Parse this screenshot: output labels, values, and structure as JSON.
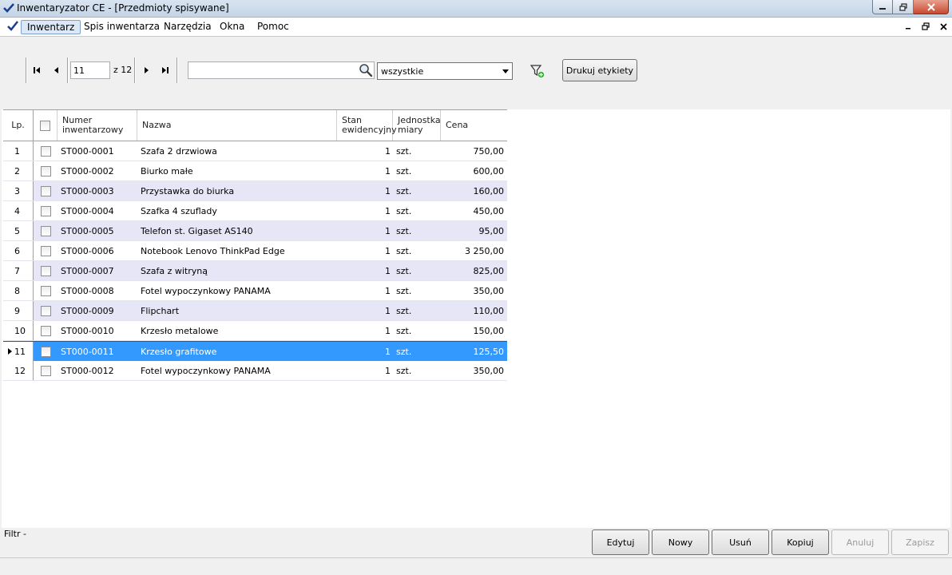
{
  "window": {
    "title": "Inwentaryzator CE - [Przedmioty spisywane]"
  },
  "menu": {
    "items": [
      {
        "label": "Inwentarz",
        "active": true
      },
      {
        "label": "Spis inwentarza"
      },
      {
        "label": "Narzędzia"
      },
      {
        "label": "Okna"
      },
      {
        "label": "Pomoc"
      }
    ]
  },
  "toolbar": {
    "page_value": "11",
    "page_total": "z 12",
    "search_value": "",
    "filter_combo": "wszystkie",
    "print_labels": "Drukuj etykiety"
  },
  "grid": {
    "headers": {
      "lp": "Lp.",
      "numer_line1": "Numer",
      "numer_line2": "inwentarzowy",
      "nazwa": "Nazwa",
      "stan_line1": "Stan",
      "stan_line2": "ewidencyjny",
      "jm_line1": "Jednostka",
      "jm_line2": "miary",
      "cena": "Cena"
    },
    "rows": [
      {
        "lp": "1",
        "numer": "ST000-0001",
        "nazwa": "Szafa 2 drzwiowa",
        "stan": "1",
        "jm": "szt.",
        "cena": "750,00"
      },
      {
        "lp": "2",
        "numer": "ST000-0002",
        "nazwa": "Biurko małe",
        "stan": "1",
        "jm": "szt.",
        "cena": "600,00"
      },
      {
        "lp": "3",
        "numer": "ST000-0003",
        "nazwa": "Przystawka do biurka",
        "stan": "1",
        "jm": "szt.",
        "cena": "160,00"
      },
      {
        "lp": "4",
        "numer": "ST000-0004",
        "nazwa": "Szafka 4 szuflady",
        "stan": "1",
        "jm": "szt.",
        "cena": "450,00"
      },
      {
        "lp": "5",
        "numer": "ST000-0005",
        "nazwa": "Telefon st. Gigaset AS140",
        "stan": "1",
        "jm": "szt.",
        "cena": "95,00"
      },
      {
        "lp": "6",
        "numer": "ST000-0006",
        "nazwa": "Notebook Lenovo ThinkPad Edge",
        "stan": "1",
        "jm": "szt.",
        "cena": "3 250,00"
      },
      {
        "lp": "7",
        "numer": "ST000-0007",
        "nazwa": "Szafa z witryną",
        "stan": "1",
        "jm": "szt.",
        "cena": "825,00"
      },
      {
        "lp": "8",
        "numer": "ST000-0008",
        "nazwa": "Fotel wypoczynkowy PANAMA",
        "stan": "1",
        "jm": "szt.",
        "cena": "350,00"
      },
      {
        "lp": "9",
        "numer": "ST000-0009",
        "nazwa": "Flipchart",
        "stan": "1",
        "jm": "szt.",
        "cena": "110,00"
      },
      {
        "lp": "10",
        "numer": "ST000-0010",
        "nazwa": "Krzesło metalowe",
        "stan": "1",
        "jm": "szt.",
        "cena": "150,00"
      },
      {
        "lp": "11",
        "numer": "ST000-0011",
        "nazwa": "Krzesło grafitowe",
        "stan": "1",
        "jm": "szt.",
        "cena": "125,50",
        "selected": true
      },
      {
        "lp": "12",
        "numer": "ST000-0012",
        "nazwa": "Fotel wypoczynkowy PANAMA",
        "stan": "1",
        "jm": "szt.",
        "cena": "350,00"
      }
    ]
  },
  "bottom": {
    "filter_label": "Filtr -",
    "buttons": [
      {
        "label": "Edytuj",
        "enabled": true
      },
      {
        "label": "Nowy",
        "enabled": true
      },
      {
        "label": "Usuń",
        "enabled": true
      },
      {
        "label": "Kopiuj",
        "enabled": true
      },
      {
        "label": "Anuluj",
        "enabled": false
      },
      {
        "label": "Zapisz",
        "enabled": false
      }
    ]
  },
  "colors": {
    "selection": "#3399ff",
    "alt_row": "#e6e6f7"
  },
  "icons": [
    "checkmark-app-icon",
    "first-page-icon",
    "prev-page-icon",
    "next-page-icon",
    "last-page-icon",
    "search-icon",
    "filter-add-icon",
    "minimize-icon",
    "restore-icon",
    "close-icon"
  ]
}
